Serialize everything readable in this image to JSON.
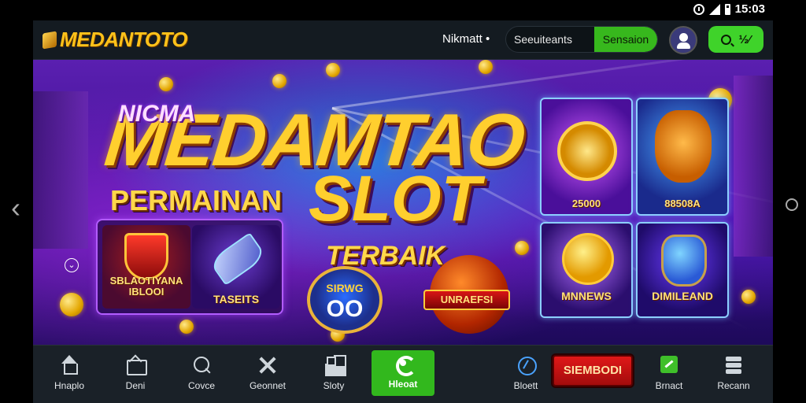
{
  "status_bar": {
    "time": "15:03",
    "icons": [
      "alarm-icon",
      "signal-icon",
      "battery-icon"
    ]
  },
  "header": {
    "logo": "MEDANTOTO",
    "nav_link": "Nikmatt •",
    "search_placeholder": "Seeuiteants",
    "search_button": "Sensaion",
    "action_button_label": " ½⁄"
  },
  "banner": {
    "title_small": "NICMA",
    "title_big": "MEDAMTAO",
    "title_permainan": "PERMAINAN",
    "title_slot": "SLOT",
    "title_terbaik": "TERBAIK",
    "feature_left": "SBLAOTIYANA IBLOOI",
    "feature_right": "TASEITS",
    "emblem1_text": "SIRWG",
    "emblem1_oo": "OO",
    "emblem2_ribbon": "UNRAEFSI",
    "tiles": [
      {
        "label": "25000"
      },
      {
        "label": "88508A"
      },
      {
        "label": "MNNEWS"
      },
      {
        "label": "DIMILEAND"
      }
    ]
  },
  "bottom_nav": {
    "items": [
      {
        "label": "Hnaplo",
        "icon": "home-icon"
      },
      {
        "label": "Deni",
        "icon": "mail-icon"
      },
      {
        "label": "Covce",
        "icon": "search-icon"
      },
      {
        "label": "Geonnet",
        "icon": "tools-icon"
      },
      {
        "label": "Sloty",
        "icon": "grid-icon"
      },
      {
        "label": "Hleoat",
        "icon": "refresh-icon"
      },
      {
        "label": "Bloett",
        "icon": "compass-icon"
      },
      {
        "label": "Brnact",
        "icon": "edit-icon"
      },
      {
        "label": "Recann",
        "icon": "stack-icon"
      }
    ],
    "red_button": "SIEMBODI"
  },
  "colors": {
    "accent_green": "#37b81d",
    "logo_gold": "#ffc21a",
    "header_bg": "#141b21"
  }
}
